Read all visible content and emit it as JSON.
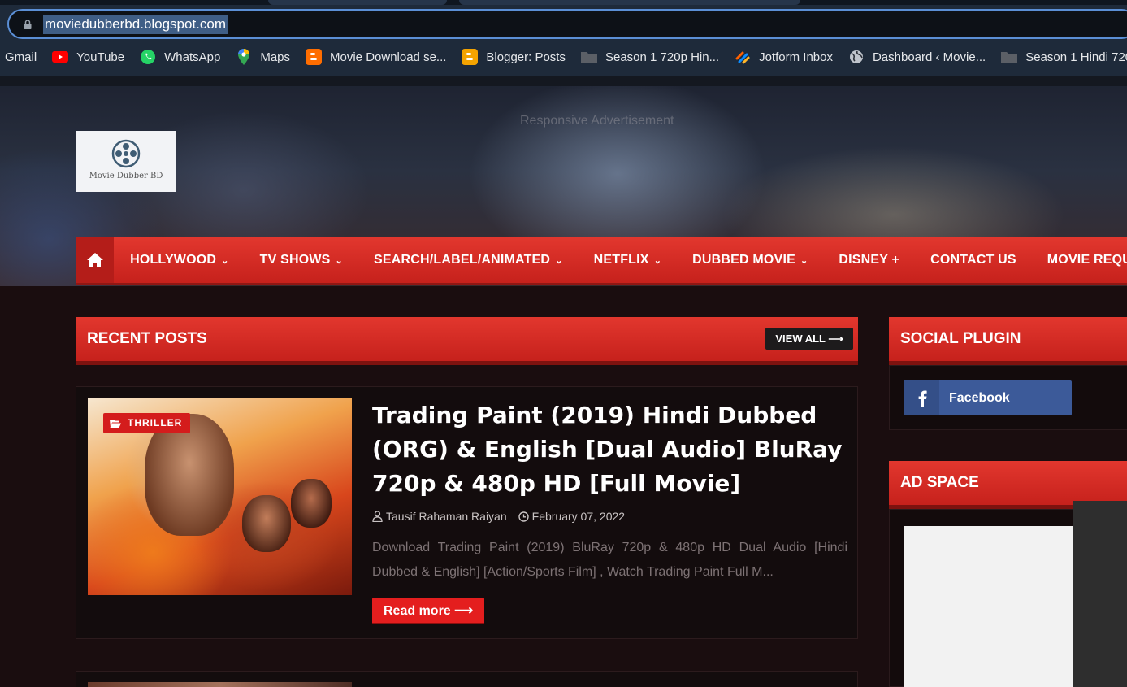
{
  "browser": {
    "url": "moviedubberbd.blogspot.com",
    "bookmarks": [
      {
        "label": "Gmail",
        "icon": "none"
      },
      {
        "label": "YouTube",
        "icon": "youtube-icon"
      },
      {
        "label": "WhatsApp",
        "icon": "whatsapp-icon"
      },
      {
        "label": "Maps",
        "icon": "maps-icon"
      },
      {
        "label": "Movie Download se...",
        "icon": "blogger-icon"
      },
      {
        "label": "Blogger: Posts",
        "icon": "blogger-icon"
      },
      {
        "label": "Season 1 720p Hin...",
        "icon": "folder-icon"
      },
      {
        "label": "Jotform Inbox",
        "icon": "jotform-icon"
      },
      {
        "label": "Dashboard ‹ Movie...",
        "icon": "globe-icon"
      },
      {
        "label": "Season 1 Hindi 720",
        "icon": "folder-icon"
      }
    ]
  },
  "header": {
    "logo_text": "Movie Dubber BD",
    "ad_label": "Responsive Advertisement"
  },
  "nav": {
    "items": [
      {
        "label": "HOLLYWOOD",
        "dropdown": true
      },
      {
        "label": "TV SHOWS",
        "dropdown": true
      },
      {
        "label": "SEARCH/LABEL/ANIMATED",
        "dropdown": true
      },
      {
        "label": "NETFLIX",
        "dropdown": true
      },
      {
        "label": "DUBBED MOVIE",
        "dropdown": true
      },
      {
        "label": "DISNEY +",
        "dropdown": false
      },
      {
        "label": "CONTACT US",
        "dropdown": false
      },
      {
        "label": "MOVIE REQU",
        "dropdown": false
      }
    ]
  },
  "recent": {
    "title": "RECENT POSTS",
    "view_all": "VIEW ALL ⟶"
  },
  "post": {
    "category": "THRILLER",
    "title": "Trading Paint (2019) Hindi Dubbed (ORG) & English [Dual Audio] BluRay 720p & 480p HD [Full Movie]",
    "author": "Tausif Rahaman Raiyan",
    "date": "February 07, 2022",
    "excerpt": "Download Trading Paint (2019) BluRay 720p & 480p HD Dual Audio [Hindi Dubbed & English] [Action/Sports Film] ,   Watch Trading Paint Full M...",
    "read_more": "Read more ⟶"
  },
  "sidebar": {
    "social_title": "SOCIAL PLUGIN",
    "facebook_label": "Facebook",
    "ad_title": "AD SPACE"
  },
  "colors": {
    "accent_red": "#d4231f",
    "facebook_blue": "#3c5a99",
    "background": "#1a0d0f"
  }
}
